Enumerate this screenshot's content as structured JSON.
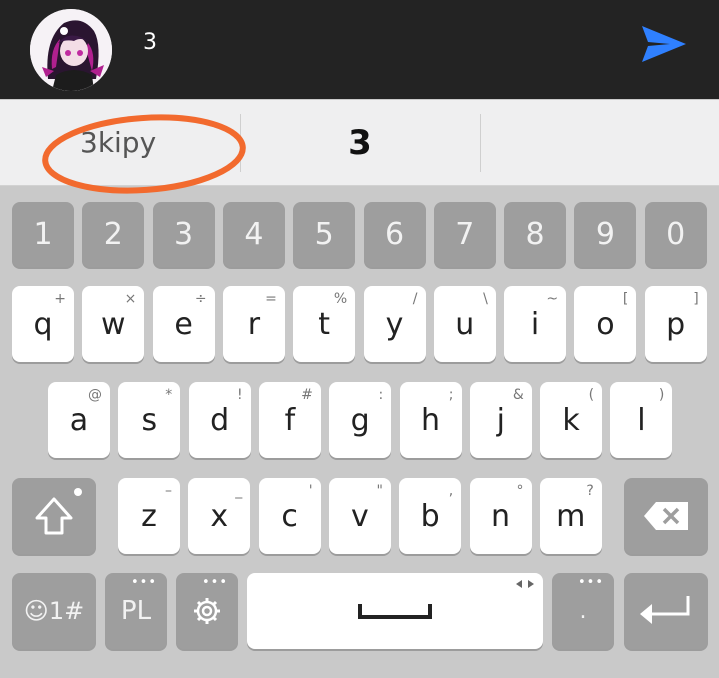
{
  "header": {
    "message_text": "3",
    "avatar_icon": "avatar-image",
    "send_icon": "send-icon",
    "send_color": "#2f80ff"
  },
  "suggestions": {
    "left": "3kipy",
    "middle": "3",
    "right": ""
  },
  "keys": {
    "numbers": [
      "1",
      "2",
      "3",
      "4",
      "5",
      "6",
      "7",
      "8",
      "9",
      "0"
    ],
    "row1": [
      {
        "p": "q",
        "s": "+"
      },
      {
        "p": "w",
        "s": "×"
      },
      {
        "p": "e",
        "s": "÷"
      },
      {
        "p": "r",
        "s": "="
      },
      {
        "p": "t",
        "s": "%"
      },
      {
        "p": "y",
        "s": "/"
      },
      {
        "p": "u",
        "s": "\\"
      },
      {
        "p": "i",
        "s": "~"
      },
      {
        "p": "o",
        "s": "["
      },
      {
        "p": "p",
        "s": "]"
      }
    ],
    "row2": [
      {
        "p": "a",
        "s": "@"
      },
      {
        "p": "s",
        "s": "*"
      },
      {
        "p": "d",
        "s": "!"
      },
      {
        "p": "f",
        "s": "#"
      },
      {
        "p": "g",
        "s": ":"
      },
      {
        "p": "h",
        "s": ";"
      },
      {
        "p": "j",
        "s": "&"
      },
      {
        "p": "k",
        "s": "("
      },
      {
        "p": "l",
        "s": ")"
      }
    ],
    "row3": [
      {
        "p": "z",
        "s": "–"
      },
      {
        "p": "x",
        "s": "_"
      },
      {
        "p": "c",
        "s": "'"
      },
      {
        "p": "v",
        "s": "\""
      },
      {
        "p": "b",
        "s": ","
      },
      {
        "p": "n",
        "s": "°"
      },
      {
        "p": "m",
        "s": "?"
      }
    ],
    "symbols_label": "☺1#",
    "language_label": "PL",
    "period_label": ".",
    "shift_icon": "shift-icon",
    "backspace_icon": "backspace-icon",
    "settings_icon": "gear-icon",
    "enter_icon": "enter-icon",
    "space_icon": "space-bar-icon"
  },
  "colors": {
    "highlight_circle": "#f26a2e",
    "top_bar": "#232323",
    "keyboard_bg": "#c9c9c9"
  }
}
